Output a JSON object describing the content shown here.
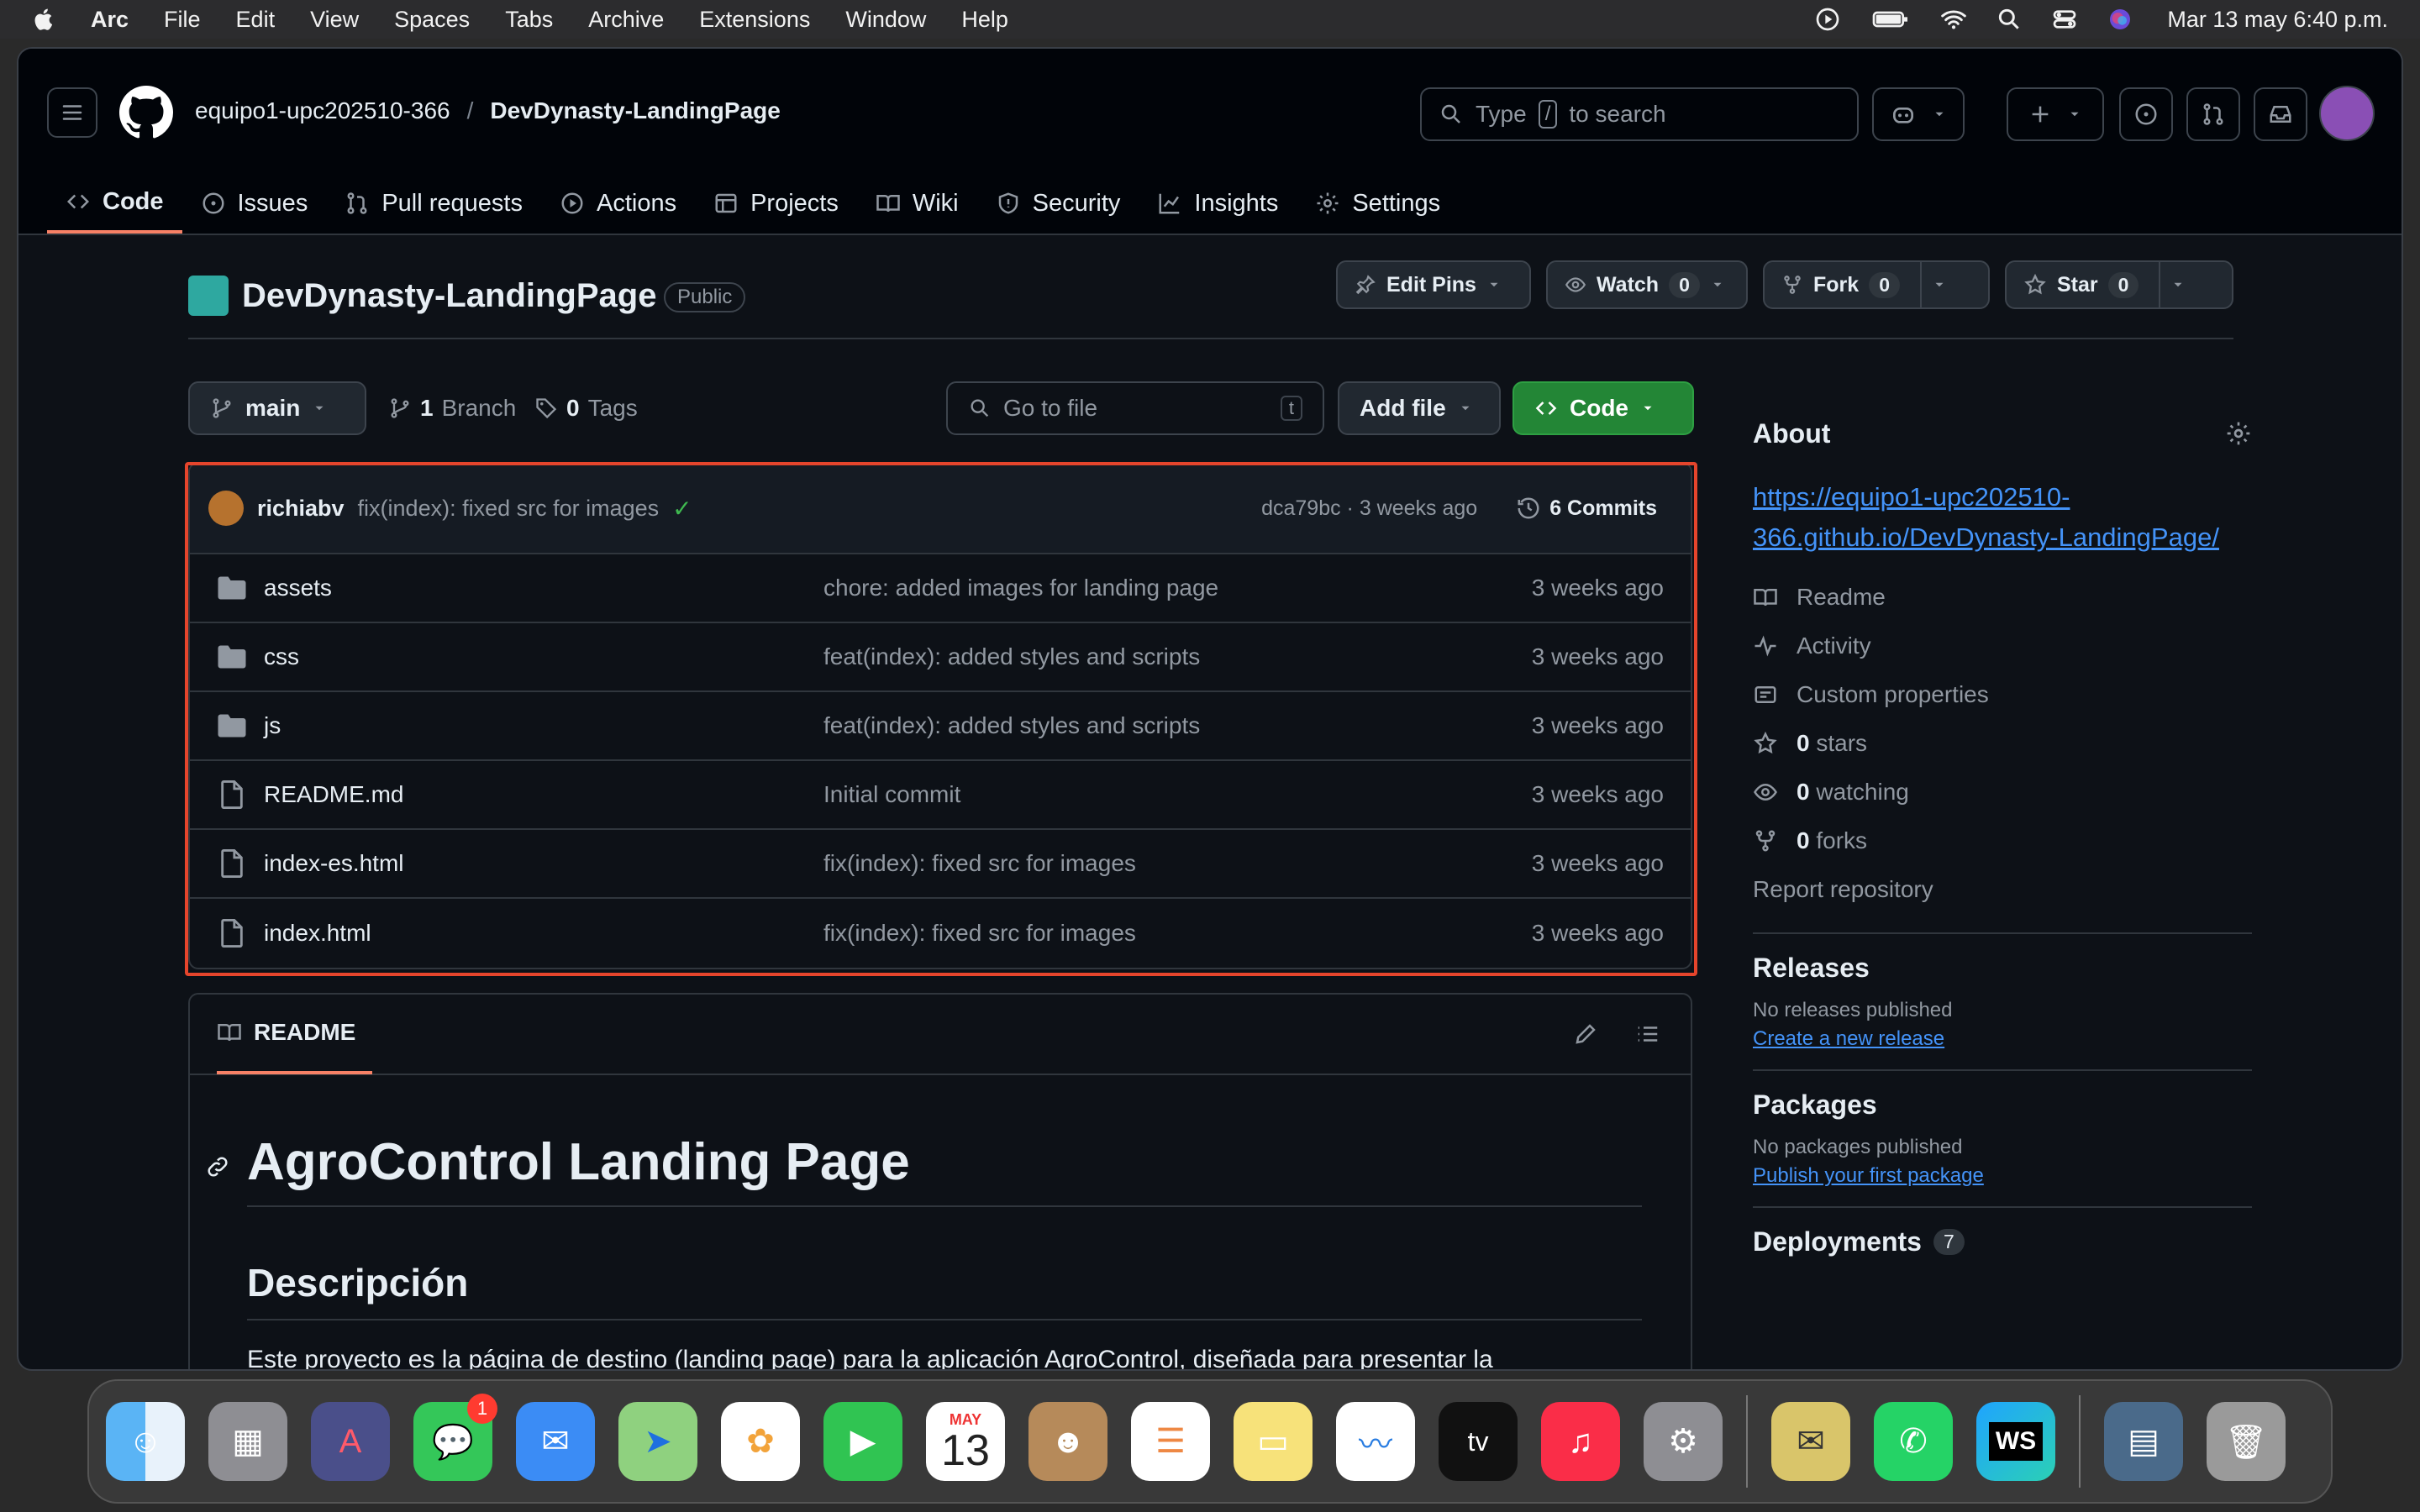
{
  "menubar": {
    "app": "Arc",
    "items": [
      "File",
      "Edit",
      "View",
      "Spaces",
      "Tabs",
      "Archive",
      "Extensions",
      "Window",
      "Help"
    ],
    "clock": "Mar 13 may 6:40 p.m."
  },
  "header": {
    "owner": "equipo1-upc202510-366",
    "separator": "/",
    "repo": "DevDynasty-LandingPage",
    "search_pre": "Type",
    "search_key": "/",
    "search_post": "to search"
  },
  "tabs": [
    {
      "label": "Code",
      "icon": "code-icon"
    },
    {
      "label": "Issues",
      "icon": "issue-icon"
    },
    {
      "label": "Pull requests",
      "icon": "pull-request-icon"
    },
    {
      "label": "Actions",
      "icon": "play-icon"
    },
    {
      "label": "Projects",
      "icon": "table-icon"
    },
    {
      "label": "Wiki",
      "icon": "book-icon"
    },
    {
      "label": "Security",
      "icon": "shield-icon"
    },
    {
      "label": "Insights",
      "icon": "graph-icon"
    },
    {
      "label": "Settings",
      "icon": "gear-icon"
    }
  ],
  "repohead": {
    "name": "DevDynasty-LandingPage",
    "visibility": "Public",
    "edit_pins": "Edit Pins",
    "watch": "Watch",
    "watch_count": "0",
    "fork": "Fork",
    "fork_count": "0",
    "star": "Star",
    "star_count": "0"
  },
  "toolbar": {
    "branch": "main",
    "branches_count": "1",
    "branches_label": "Branch",
    "tags_count": "0",
    "tags_label": "Tags",
    "goto_placeholder": "Go to file",
    "goto_key": "t",
    "add_file": "Add file",
    "code": "Code"
  },
  "commit": {
    "author": "richiabv",
    "message": "fix(index): fixed src for images",
    "check": "✓",
    "hash_time": "dca79bc · 3 weeks ago",
    "commits": "6 Commits"
  },
  "files": [
    {
      "name": "assets",
      "type": "folder",
      "message": "chore: added images for landing page",
      "date": "3 weeks ago"
    },
    {
      "name": "css",
      "type": "folder",
      "message": "feat(index): added styles and scripts",
      "date": "3 weeks ago"
    },
    {
      "name": "js",
      "type": "folder",
      "message": "feat(index): added styles and scripts",
      "date": "3 weeks ago"
    },
    {
      "name": "README.md",
      "type": "file",
      "message": "Initial commit",
      "date": "3 weeks ago"
    },
    {
      "name": "index-es.html",
      "type": "file",
      "message": "fix(index): fixed src for images",
      "date": "3 weeks ago"
    },
    {
      "name": "index.html",
      "type": "file",
      "message": "fix(index): fixed src for images",
      "date": "3 weeks ago"
    }
  ],
  "readme": {
    "tab": "README",
    "h1": "AgroControl Landing Page",
    "h2": "Descripción",
    "para": "Este proyecto es la página de destino (landing page) para la aplicación AgroControl, diseñada para presentar la"
  },
  "about": {
    "title": "About",
    "link_line1": "https://equipo1-upc202510-",
    "link_line2": "366.github.io/DevDynasty-LandingPage/",
    "readme": "Readme",
    "activity": "Activity",
    "custom": "Custom properties",
    "stars_n": "0",
    "stars": "stars",
    "watching_n": "0",
    "watching": "watching",
    "forks_n": "0",
    "forks": "forks",
    "report": "Report repository"
  },
  "releases": {
    "title": "Releases",
    "none": "No releases published",
    "link": "Create a new release"
  },
  "packages": {
    "title": "Packages",
    "none": "No packages published",
    "link": "Publish your first package"
  },
  "deployments": {
    "title": "Deployments",
    "count": "7"
  },
  "dock": {
    "calendar_month": "MAY",
    "calendar_day": "13",
    "messages_badge": "1",
    "tv": "tv",
    "ws": "WS"
  },
  "colors": {
    "accent": "#f78166",
    "green": "#238636",
    "link": "#4493f8",
    "highlight": "#e5452c"
  }
}
